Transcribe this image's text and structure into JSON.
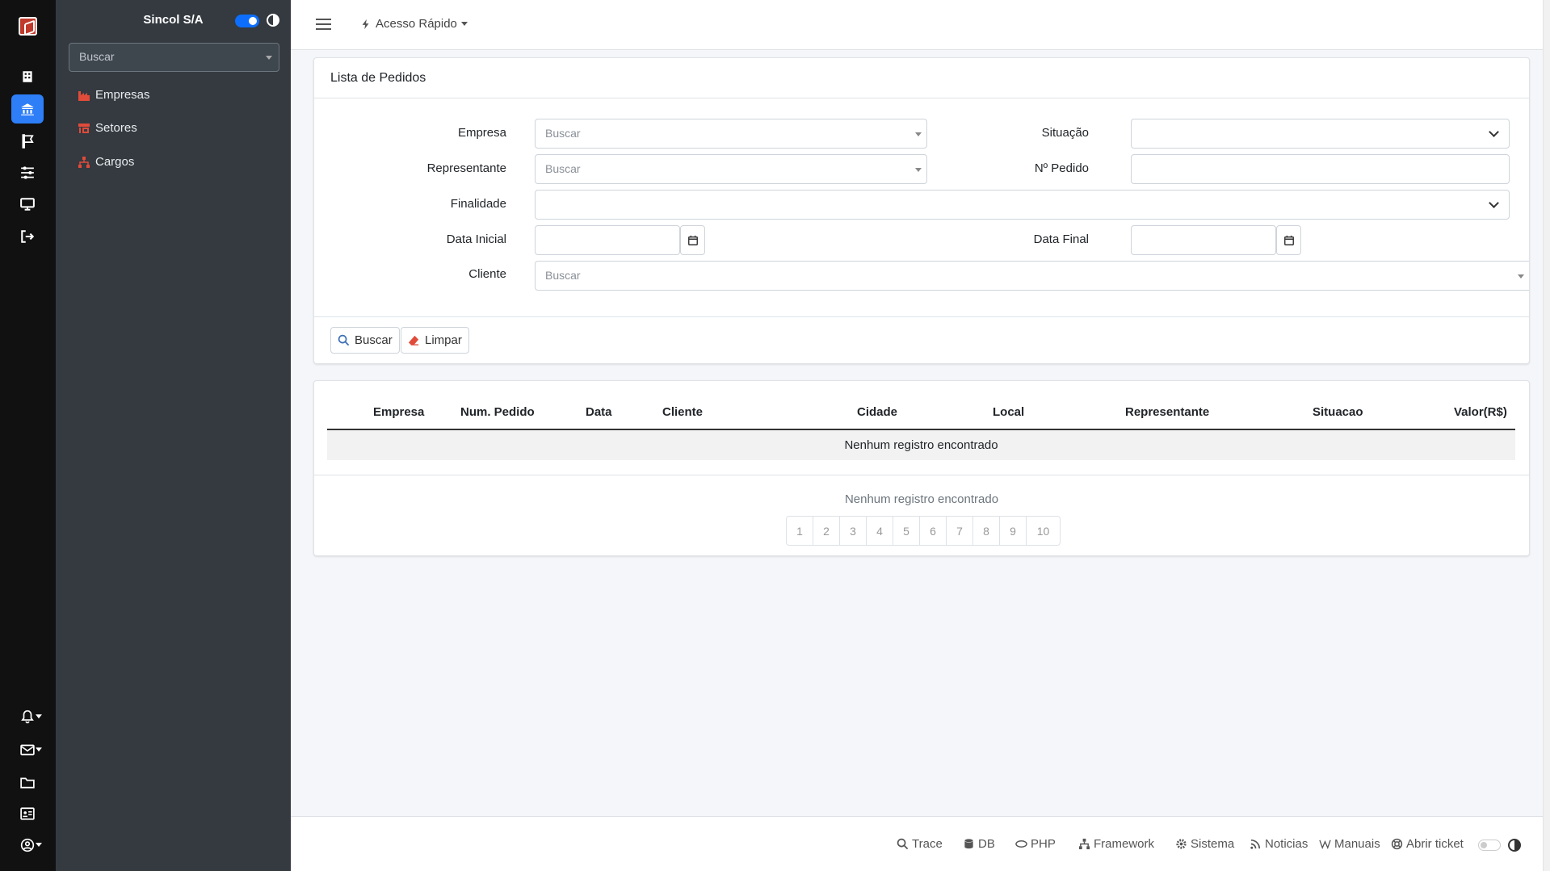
{
  "sidebar": {
    "company": "Sincol S/A",
    "search_placeholder": "Buscar",
    "items": [
      {
        "label": "Empresas"
      },
      {
        "label": "Setores"
      },
      {
        "label": "Cargos"
      }
    ]
  },
  "topbar": {
    "quick_access": "Acesso Rápido"
  },
  "filters": {
    "title": "Lista de Pedidos",
    "empresa_label": "Empresa",
    "empresa_placeholder": "Buscar",
    "situacao_label": "Situação",
    "representante_label": "Representante",
    "representante_placeholder": "Buscar",
    "pedido_label": "Nº Pedido",
    "finalidade_label": "Finalidade",
    "data_inicial_label": "Data Inicial",
    "data_final_label": "Data Final",
    "cliente_label": "Cliente",
    "cliente_placeholder": "Buscar",
    "search_button": "Buscar",
    "clear_button": "Limpar"
  },
  "table": {
    "columns": [
      "Empresa",
      "Num. Pedido",
      "Data",
      "Cliente",
      "Cidade",
      "Local",
      "Representante",
      "Situacao",
      "Valor(R$)"
    ],
    "empty_row": "Nenhum registro encontrado",
    "footer_message": "Nenhum registro encontrado",
    "pages": [
      "1",
      "2",
      "3",
      "4",
      "5",
      "6",
      "7",
      "8",
      "9",
      "10"
    ]
  },
  "footer": {
    "links": [
      "Trace",
      "DB",
      "PHP",
      "Framework",
      "Sistema",
      "Noticias",
      "Manuais",
      "Abrir ticket"
    ]
  },
  "colors": {
    "accent": "#2d7ef7",
    "sidebar_bg": "#343a40",
    "rail_bg": "#111111",
    "menu_icon": "#e04b3a"
  }
}
